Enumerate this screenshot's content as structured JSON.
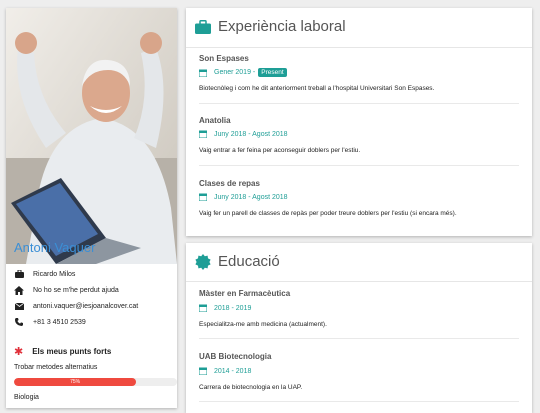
{
  "profile": {
    "name": "Antoni Vaquer",
    "contacts": [
      {
        "icon": "briefcase-icon",
        "text": "Ricardo Milos"
      },
      {
        "icon": "home-icon",
        "text": "No ho se m'he perdut ajuda"
      },
      {
        "icon": "envelope-icon",
        "text": "antoni.vaquer@iesjoanalcover.cat"
      },
      {
        "icon": "phone-icon",
        "text": "+81 3 4510 2539"
      }
    ],
    "skills_title": "Els meus punts forts",
    "skills": [
      {
        "label": "Trobar metodes alternatius",
        "percent": 75,
        "percent_label": "75%"
      },
      {
        "label": "Biologia"
      }
    ],
    "accent_color": "#3b8fd6",
    "skill_bar_color": "#ef4a3f"
  },
  "experience": {
    "title": "Experiència laboral",
    "icon": "briefcase-icon",
    "entries": [
      {
        "title": "Son Espases",
        "date": "Gener 2019 -",
        "badge": "Present",
        "desc": "Biotecnòleg i com he dit anteriorment treball a l'hospital Universitari Son Espases."
      },
      {
        "title": "Anatolia",
        "date": "Juny 2018 - Agost 2018",
        "desc": "Vaig entrar a fer feina per aconseguir doblers per l'estiu."
      },
      {
        "title": "Clases de repas",
        "date": "Juny 2018 - Agost 2018",
        "desc": "Vaig fer un parell de classes de repàs per poder treure doblers per l'estiu (si encara més)."
      }
    ]
  },
  "education": {
    "title": "Educació",
    "icon": "certificate-icon",
    "entries": [
      {
        "title": "Màster en Farmacèutica",
        "date": "2018 - 2019",
        "desc": "Especialitza-me amb medicina (actualment)."
      },
      {
        "title": "UAB Biotecnologia",
        "date": "2014 - 2018",
        "desc": "Carrera de biotecnologia en la UAP."
      }
    ]
  },
  "colors": {
    "teal": "#1e9e96",
    "background": "#eeeeee"
  }
}
